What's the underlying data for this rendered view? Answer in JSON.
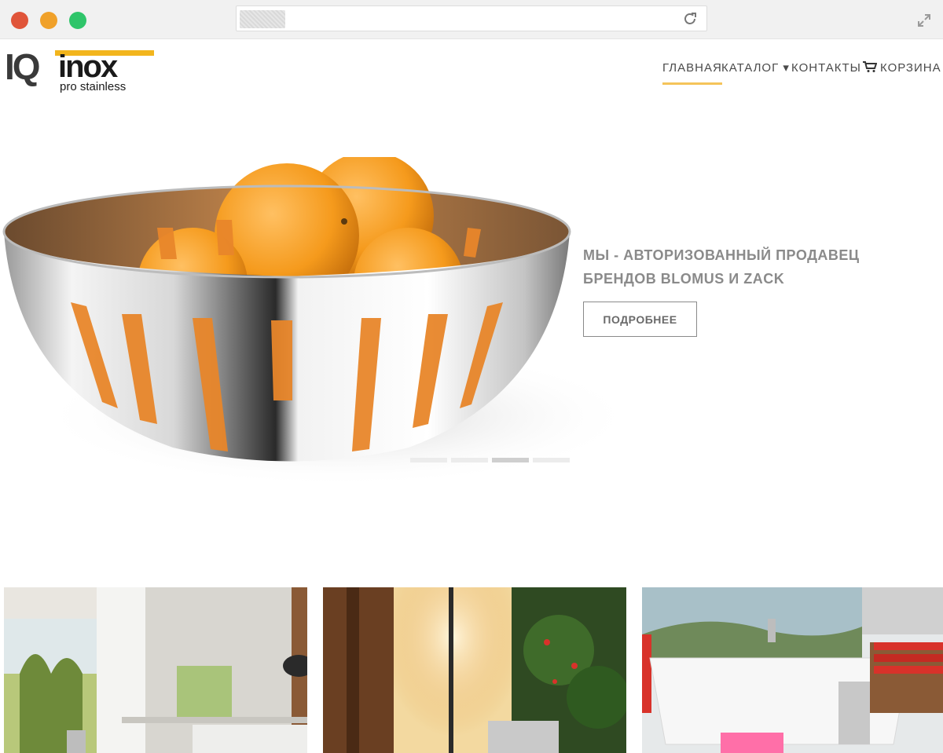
{
  "browser": {
    "controls": [
      "close",
      "minimize",
      "maximize"
    ],
    "reload_icon": "reload-icon",
    "expand_icon": "expand-icon"
  },
  "logo": {
    "text_iq": "IQ",
    "text_inox": "inox",
    "tagline": "pro stainless"
  },
  "nav": {
    "items": [
      {
        "label": "ГЛАВНАЯ",
        "active": true
      },
      {
        "label": "КАТАЛОГ ▾",
        "active": false
      },
      {
        "label": "КОНТАКТЫ",
        "active": false
      },
      {
        "label": "КОРЗИНА",
        "active": false,
        "icon": "cart-icon"
      }
    ]
  },
  "hero": {
    "title": "МЫ - АВТОРИЗОВАННЫЙ ПРОДАВЕЦ БРЕНДОВ BLOMUS И ZACK",
    "button_label": "ПОДРОБНЕЕ",
    "slides": 4,
    "active_slide": 3
  },
  "colors": {
    "accent": "#f5c45a",
    "logo_yellow": "#f2b51d",
    "text_gray": "#8a8a8a"
  },
  "cards": [
    "kitchen-interior",
    "sunlit-room-interior",
    "bathroom-interior"
  ]
}
